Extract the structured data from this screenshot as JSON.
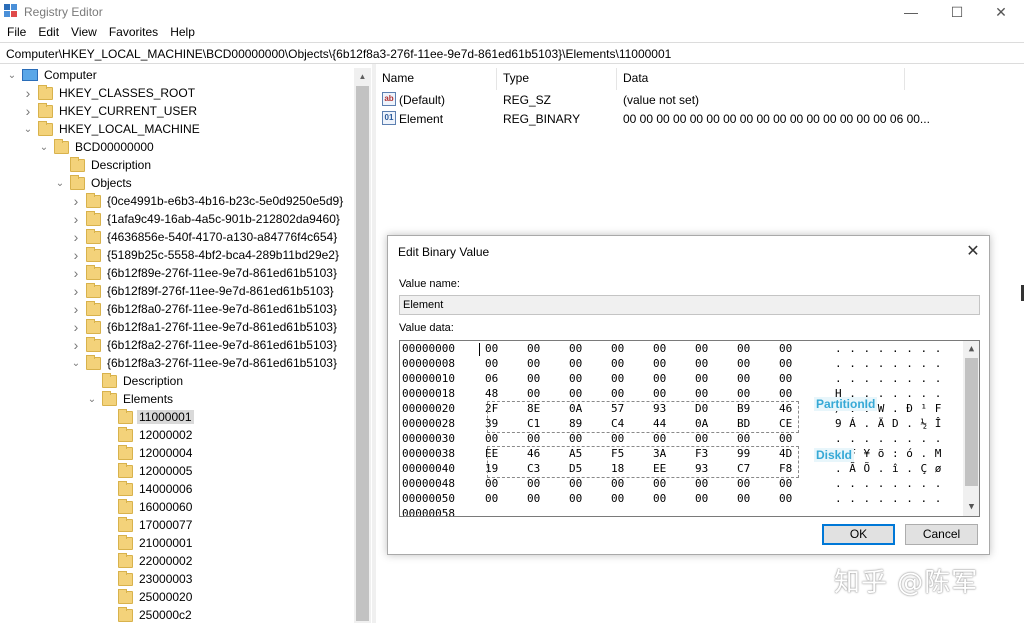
{
  "window": {
    "title": "Registry Editor",
    "icon": "registry-icon",
    "controls": {
      "minimize": "—",
      "maximize": "☐",
      "close": "✕"
    }
  },
  "menu": [
    "File",
    "Edit",
    "View",
    "Favorites",
    "Help"
  ],
  "address": "Computer\\HKEY_LOCAL_MACHINE\\BCD00000000\\Objects\\{6b12f8a3-276f-11ee-9e7d-861ed61b5103}\\Elements\\11000001",
  "tree": {
    "nodes": [
      {
        "label": "Computer",
        "level": 0,
        "state": "expanded",
        "type": "computer"
      },
      {
        "label": "HKEY_CLASSES_ROOT",
        "level": 1,
        "state": "collapsed",
        "type": "folder"
      },
      {
        "label": "HKEY_CURRENT_USER",
        "level": 1,
        "state": "collapsed",
        "type": "folder"
      },
      {
        "label": "HKEY_LOCAL_MACHINE",
        "level": 1,
        "state": "expanded",
        "type": "folder"
      },
      {
        "label": "BCD00000000",
        "level": 2,
        "state": "expanded",
        "type": "folder"
      },
      {
        "label": "Description",
        "level": 3,
        "state": "none",
        "type": "folder"
      },
      {
        "label": "Objects",
        "level": 3,
        "state": "expanded",
        "type": "folder"
      },
      {
        "label": "{0ce4991b-e6b3-4b16-b23c-5e0d9250e5d9}",
        "level": 4,
        "state": "collapsed",
        "type": "folder"
      },
      {
        "label": "{1afa9c49-16ab-4a5c-901b-212802da9460}",
        "level": 4,
        "state": "collapsed",
        "type": "folder"
      },
      {
        "label": "{4636856e-540f-4170-a130-a84776f4c654}",
        "level": 4,
        "state": "collapsed",
        "type": "folder"
      },
      {
        "label": "{5189b25c-5558-4bf2-bca4-289b11bd29e2}",
        "level": 4,
        "state": "collapsed",
        "type": "folder"
      },
      {
        "label": "{6b12f89e-276f-11ee-9e7d-861ed61b5103}",
        "level": 4,
        "state": "collapsed",
        "type": "folder"
      },
      {
        "label": "{6b12f89f-276f-11ee-9e7d-861ed61b5103}",
        "level": 4,
        "state": "collapsed",
        "type": "folder"
      },
      {
        "label": "{6b12f8a0-276f-11ee-9e7d-861ed61b5103}",
        "level": 4,
        "state": "collapsed",
        "type": "folder"
      },
      {
        "label": "{6b12f8a1-276f-11ee-9e7d-861ed61b5103}",
        "level": 4,
        "state": "collapsed",
        "type": "folder"
      },
      {
        "label": "{6b12f8a2-276f-11ee-9e7d-861ed61b5103}",
        "level": 4,
        "state": "collapsed",
        "type": "folder"
      },
      {
        "label": "{6b12f8a3-276f-11ee-9e7d-861ed61b5103}",
        "level": 4,
        "state": "expanded",
        "type": "folder"
      },
      {
        "label": "Description",
        "level": 5,
        "state": "none",
        "type": "folder"
      },
      {
        "label": "Elements",
        "level": 5,
        "state": "expanded",
        "type": "folder"
      },
      {
        "label": "11000001",
        "level": 6,
        "state": "none",
        "type": "folder",
        "selected": true
      },
      {
        "label": "12000002",
        "level": 6,
        "state": "none",
        "type": "folder"
      },
      {
        "label": "12000004",
        "level": 6,
        "state": "none",
        "type": "folder"
      },
      {
        "label": "12000005",
        "level": 6,
        "state": "none",
        "type": "folder"
      },
      {
        "label": "14000006",
        "level": 6,
        "state": "none",
        "type": "folder"
      },
      {
        "label": "16000060",
        "level": 6,
        "state": "none",
        "type": "folder"
      },
      {
        "label": "17000077",
        "level": 6,
        "state": "none",
        "type": "folder"
      },
      {
        "label": "21000001",
        "level": 6,
        "state": "none",
        "type": "folder"
      },
      {
        "label": "22000002",
        "level": 6,
        "state": "none",
        "type": "folder"
      },
      {
        "label": "23000003",
        "level": 6,
        "state": "none",
        "type": "folder"
      },
      {
        "label": "25000020",
        "level": 6,
        "state": "none",
        "type": "folder"
      },
      {
        "label": "250000c2",
        "level": 6,
        "state": "none",
        "type": "folder"
      }
    ]
  },
  "list": {
    "columns": [
      "Name",
      "Type",
      "Data"
    ],
    "rows": [
      {
        "icon": "string-value-icon",
        "name": "(Default)",
        "type": "REG_SZ",
        "data": "(value not set)"
      },
      {
        "icon": "binary-value-icon",
        "name": "Element",
        "type": "REG_BINARY",
        "data": "00 00 00 00 00 00 00 00 00 00 00 00 00 00 00 00 06 00..."
      }
    ]
  },
  "dialog": {
    "title": "Edit Binary Value",
    "value_name_label": "Value name:",
    "value_name": "Element",
    "value_data_label": "Value data:",
    "ok": "OK",
    "cancel": "Cancel",
    "hex_rows": [
      {
        "addr": "00000000",
        "bytes": [
          "00",
          "00",
          "00",
          "00",
          "00",
          "00",
          "00",
          "00"
        ],
        "ascii": ". . . . . . . ."
      },
      {
        "addr": "00000008",
        "bytes": [
          "00",
          "00",
          "00",
          "00",
          "00",
          "00",
          "00",
          "00"
        ],
        "ascii": ". . . . . . . ."
      },
      {
        "addr": "00000010",
        "bytes": [
          "06",
          "00",
          "00",
          "00",
          "00",
          "00",
          "00",
          "00"
        ],
        "ascii": ". . . . . . . ."
      },
      {
        "addr": "00000018",
        "bytes": [
          "48",
          "00",
          "00",
          "00",
          "00",
          "00",
          "00",
          "00"
        ],
        "ascii": "H . . . . . . ."
      },
      {
        "addr": "00000020",
        "bytes": [
          "2F",
          "8E",
          "0A",
          "57",
          "93",
          "D0",
          "B9",
          "46"
        ],
        "ascii": "/ . . W . Ð ¹ F"
      },
      {
        "addr": "00000028",
        "bytes": [
          "39",
          "C1",
          "89",
          "C4",
          "44",
          "0A",
          "BD",
          "CE"
        ],
        "ascii": "9 Á . Ä D . ½ Î"
      },
      {
        "addr": "00000030",
        "bytes": [
          "00",
          "00",
          "00",
          "00",
          "00",
          "00",
          "00",
          "00"
        ],
        "ascii": ". . . . . . . ."
      },
      {
        "addr": "00000038",
        "bytes": [
          "EE",
          "46",
          "A5",
          "F5",
          "3A",
          "F3",
          "99",
          "4D"
        ],
        "ascii": "î F ¥ õ : ó . M"
      },
      {
        "addr": "00000040",
        "bytes": [
          "19",
          "C3",
          "D5",
          "18",
          "EE",
          "93",
          "C7",
          "F8"
        ],
        "ascii": ". Ã Õ . î . Ç ø"
      },
      {
        "addr": "00000048",
        "bytes": [
          "00",
          "00",
          "00",
          "00",
          "00",
          "00",
          "00",
          "00"
        ],
        "ascii": ". . . . . . . ."
      },
      {
        "addr": "00000050",
        "bytes": [
          "00",
          "00",
          "00",
          "00",
          "00",
          "00",
          "00",
          "00"
        ],
        "ascii": ". . . . . . . ."
      },
      {
        "addr": "00000058",
        "bytes": [],
        "ascii": ""
      }
    ],
    "annotations": [
      {
        "label": "PartitionId",
        "color": "#36a9d6"
      },
      {
        "label": "DiskId",
        "color": "#36a9d6"
      }
    ]
  },
  "watermark": "知乎 @陈军"
}
